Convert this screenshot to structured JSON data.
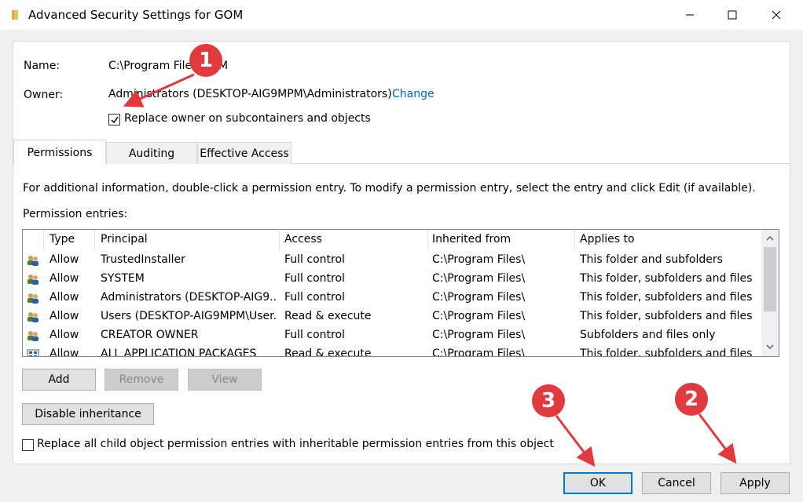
{
  "window": {
    "title": "Advanced Security Settings for GOM"
  },
  "header": {
    "name_label": "Name:",
    "name_value": "C:\\Program Files\\GOM",
    "owner_label": "Owner:",
    "owner_value": "Administrators (DESKTOP-AIG9MPM\\Administrators)",
    "change_link": "Change",
    "replace_owner_label": "Replace owner on subcontainers and objects",
    "replace_owner_checked": true
  },
  "tabs": [
    {
      "label": "Permissions",
      "active": true
    },
    {
      "label": "Auditing",
      "active": false
    },
    {
      "label": "Effective Access",
      "active": false
    }
  ],
  "info_text": "For additional information, double-click a permission entry. To modify a permission entry, select the entry and click Edit (if available).",
  "entries_label": "Permission entries:",
  "columns": [
    "Type",
    "Principal",
    "Access",
    "Inherited from",
    "Applies to"
  ],
  "entries": [
    {
      "icon": "users-icon",
      "type": "Allow",
      "principal": "TrustedInstaller",
      "access": "Full control",
      "inherited": "C:\\Program Files\\",
      "applies": "This folder and subfolders"
    },
    {
      "icon": "users-icon",
      "type": "Allow",
      "principal": "SYSTEM",
      "access": "Full control",
      "inherited": "C:\\Program Files\\",
      "applies": "This folder, subfolders and files"
    },
    {
      "icon": "users-icon",
      "type": "Allow",
      "principal": "Administrators (DESKTOP-AIG9...",
      "access": "Full control",
      "inherited": "C:\\Program Files\\",
      "applies": "This folder, subfolders and files"
    },
    {
      "icon": "users-icon",
      "type": "Allow",
      "principal": "Users (DESKTOP-AIG9MPM\\User...",
      "access": "Read & execute",
      "inherited": "C:\\Program Files\\",
      "applies": "This folder, subfolders and files"
    },
    {
      "icon": "users-icon",
      "type": "Allow",
      "principal": "CREATOR OWNER",
      "access": "Full control",
      "inherited": "C:\\Program Files\\",
      "applies": "Subfolders and files only"
    },
    {
      "icon": "app-packages-icon",
      "type": "Allow",
      "principal": "ALL APPLICATION PACKAGES",
      "access": "Read & execute",
      "inherited": "C:\\Program Files\\",
      "applies": "This folder, subfolders and files"
    }
  ],
  "buttons": {
    "add": "Add",
    "remove": "Remove",
    "view": "View",
    "disable_inheritance": "Disable inheritance",
    "ok": "OK",
    "cancel": "Cancel",
    "apply": "Apply"
  },
  "replace_child_label": "Replace all child object permission entries with inheritable permission entries from this object",
  "replace_child_checked": false,
  "annotations": {
    "badge_1": "1",
    "badge_2": "2",
    "badge_3": "3",
    "color": "#e0393e"
  },
  "colors": {
    "link": "#0066cc",
    "focus_border": "#0078d7"
  }
}
